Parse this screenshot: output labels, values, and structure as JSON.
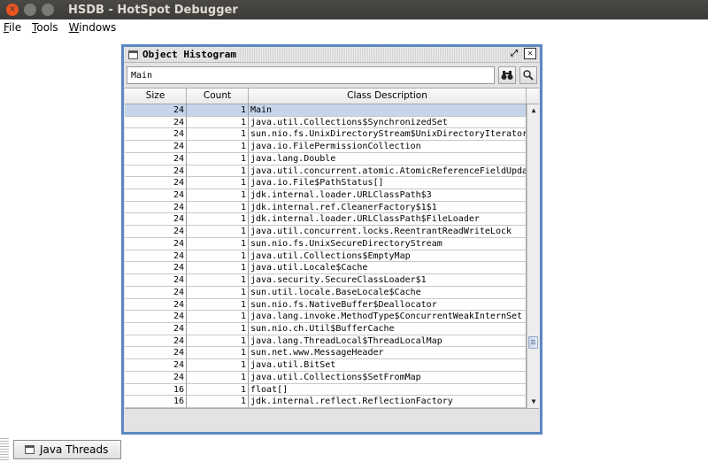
{
  "window": {
    "title": "HSDB - HotSpot Debugger"
  },
  "menu": [
    "File",
    "Tools",
    "Windows"
  ],
  "histogram": {
    "title": "Object Histogram",
    "filter_value": "Main",
    "find_icon": "binoculars-icon",
    "search_icon": "magnifier-icon",
    "columns": [
      "Size",
      "Count",
      "Class Description"
    ],
    "rows": [
      [
        "24",
        "1",
        "Main"
      ],
      [
        "24",
        "1",
        "java.util.Collections$SynchronizedSet"
      ],
      [
        "24",
        "1",
        "sun.nio.fs.UnixDirectoryStream$UnixDirectoryIterator"
      ],
      [
        "24",
        "1",
        "java.io.FilePermissionCollection"
      ],
      [
        "24",
        "1",
        "java.lang.Double"
      ],
      [
        "24",
        "1",
        "java.util.concurrent.atomic.AtomicReferenceFieldUpdater$..."
      ],
      [
        "24",
        "1",
        "java.io.File$PathStatus[]"
      ],
      [
        "24",
        "1",
        "jdk.internal.loader.URLClassPath$3"
      ],
      [
        "24",
        "1",
        "jdk.internal.ref.CleanerFactory$1$1"
      ],
      [
        "24",
        "1",
        "jdk.internal.loader.URLClassPath$FileLoader"
      ],
      [
        "24",
        "1",
        "java.util.concurrent.locks.ReentrantReadWriteLock"
      ],
      [
        "24",
        "1",
        "sun.nio.fs.UnixSecureDirectoryStream"
      ],
      [
        "24",
        "1",
        "java.util.Collections$EmptyMap"
      ],
      [
        "24",
        "1",
        "java.util.Locale$Cache"
      ],
      [
        "24",
        "1",
        "java.security.SecureClassLoader$1"
      ],
      [
        "24",
        "1",
        "sun.util.locale.BaseLocale$Cache"
      ],
      [
        "24",
        "1",
        "sun.nio.fs.NativeBuffer$Deallocator"
      ],
      [
        "24",
        "1",
        "java.lang.invoke.MethodType$ConcurrentWeakInternSet"
      ],
      [
        "24",
        "1",
        "sun.nio.ch.Util$BufferCache"
      ],
      [
        "24",
        "1",
        "java.lang.ThreadLocal$ThreadLocalMap"
      ],
      [
        "24",
        "1",
        "sun.net.www.MessageHeader"
      ],
      [
        "24",
        "1",
        "java.util.BitSet"
      ],
      [
        "24",
        "1",
        "java.util.Collections$SetFromMap"
      ],
      [
        "16",
        "1",
        "float[]"
      ],
      [
        "16",
        "1",
        "jdk.internal.reflect.ReflectionFactory"
      ]
    ],
    "selected_row": 0
  },
  "taskbar": {
    "java_threads": "Java Threads"
  },
  "colors": {
    "frame_border": "#5b88c2",
    "selection": "#c5d6ec",
    "close_button": "#e95420"
  }
}
